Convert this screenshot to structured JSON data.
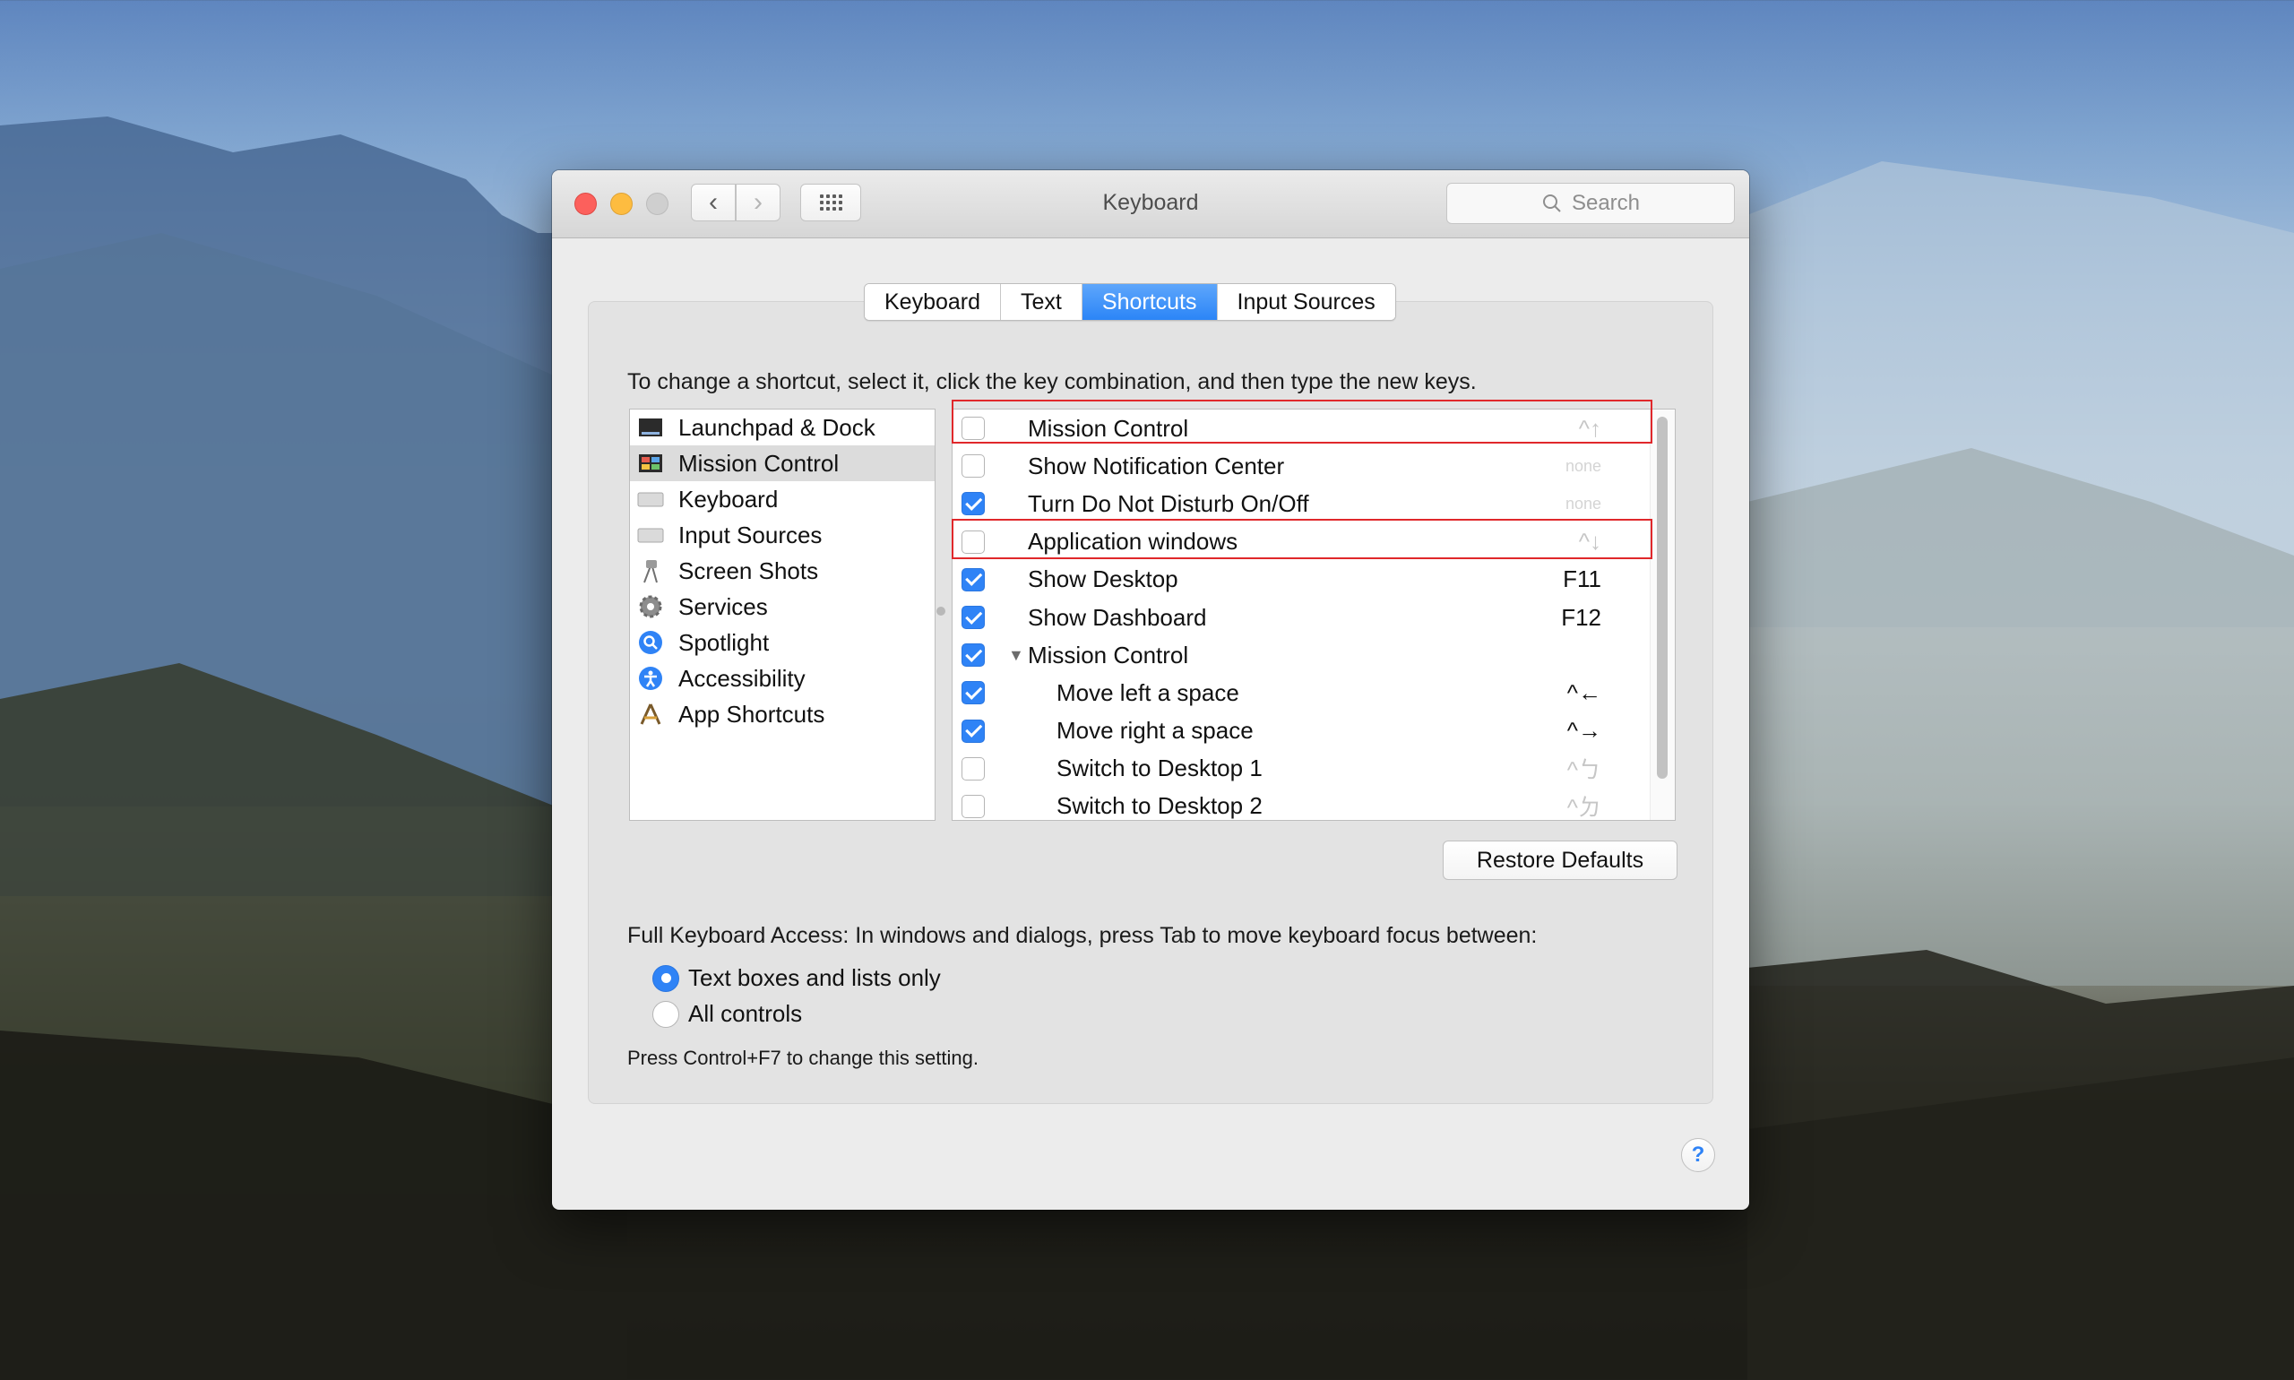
{
  "window": {
    "title": "Keyboard",
    "search_placeholder": "Search"
  },
  "tabs": [
    {
      "label": "Keyboard",
      "active": false
    },
    {
      "label": "Text",
      "active": false
    },
    {
      "label": "Shortcuts",
      "active": true
    },
    {
      "label": "Input Sources",
      "active": false
    }
  ],
  "instruction": "To change a shortcut, select it, click the key combination, and then type the new keys.",
  "categories": [
    {
      "label": "Launchpad & Dock",
      "icon": "launchpad-dock-icon",
      "selected": false
    },
    {
      "label": "Mission Control",
      "icon": "mission-control-icon",
      "selected": true
    },
    {
      "label": "Keyboard",
      "icon": "keyboard-icon",
      "selected": false
    },
    {
      "label": "Input Sources",
      "icon": "input-sources-icon",
      "selected": false
    },
    {
      "label": "Screen Shots",
      "icon": "screen-shots-icon",
      "selected": false
    },
    {
      "label": "Services",
      "icon": "services-gear-icon",
      "selected": false
    },
    {
      "label": "Spotlight",
      "icon": "spotlight-icon",
      "selected": false
    },
    {
      "label": "Accessibility",
      "icon": "accessibility-icon",
      "selected": false
    },
    {
      "label": "App Shortcuts",
      "icon": "app-shortcuts-icon",
      "selected": false
    }
  ],
  "shortcuts": [
    {
      "label": "Mission Control",
      "checked": false,
      "key": "^↑",
      "key_style": "faint"
    },
    {
      "label": "Show Notification Center",
      "checked": false,
      "key": "none",
      "key_style": "none"
    },
    {
      "label": "Turn Do Not Disturb On/Off",
      "checked": true,
      "key": "none",
      "key_style": "none"
    },
    {
      "label": "Application windows",
      "checked": false,
      "key": "^↓",
      "key_style": "faint"
    },
    {
      "label": "Show Desktop",
      "checked": true,
      "key": "F11",
      "key_style": "normal"
    },
    {
      "label": "Show Dashboard",
      "checked": true,
      "key": "F12",
      "key_style": "normal"
    },
    {
      "label": "Mission Control",
      "checked": true,
      "key": "",
      "key_style": "normal",
      "disclosure": "▼"
    },
    {
      "label": "Move left a space",
      "checked": true,
      "key": "^←",
      "key_style": "normal",
      "indent": true
    },
    {
      "label": "Move right a space",
      "checked": true,
      "key": "^→",
      "key_style": "normal",
      "indent": true
    },
    {
      "label": "Switch to Desktop 1",
      "checked": false,
      "key": "^ㄅ",
      "key_style": "faint",
      "indent": true
    },
    {
      "label": "Switch to Desktop 2",
      "checked": false,
      "key": "^ㄉ",
      "key_style": "faint",
      "indent": true
    }
  ],
  "restore_defaults_label": "Restore Defaults",
  "full_keyboard_access": {
    "label": "Full Keyboard Access: In windows and dialogs, press Tab to move keyboard focus between:",
    "options": [
      {
        "label": "Text boxes and lists only",
        "selected": true
      },
      {
        "label": "All controls",
        "selected": false
      }
    ],
    "hint": "Press Control+F7 to change this setting."
  },
  "help_label": "?",
  "colors": {
    "accent": "#2f83f6",
    "highlight_box": "#e0282b"
  }
}
